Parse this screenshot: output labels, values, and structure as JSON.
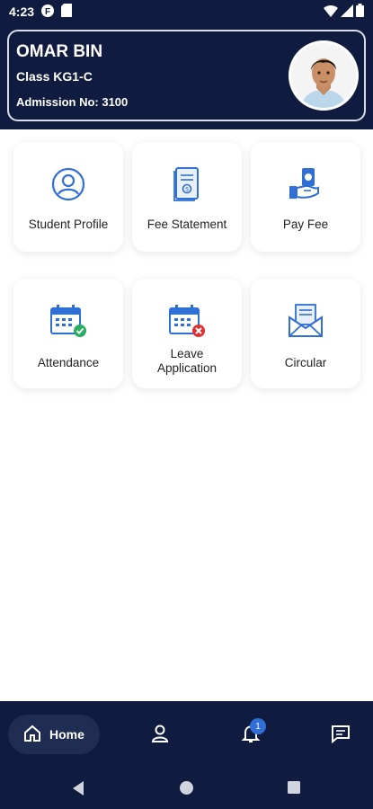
{
  "status_bar": {
    "time": "4:23",
    "icons": [
      "notification-f-icon",
      "sim-card-icon",
      "wifi-icon",
      "signal-icon",
      "battery-icon"
    ]
  },
  "profile": {
    "name": "OMAR BIN",
    "class": "Class KG1-C",
    "admission": "Admission No: 3100"
  },
  "tiles": [
    {
      "label": "Student Profile",
      "icon": "student-profile-icon"
    },
    {
      "label": "Fee Statement",
      "icon": "fee-statement-icon"
    },
    {
      "label": "Pay Fee",
      "icon": "pay-fee-icon"
    },
    {
      "label": "Attendance",
      "icon": "attendance-icon"
    },
    {
      "label_line1": "Leave",
      "label_line2": "Application",
      "icon": "leave-application-icon"
    },
    {
      "label": "Circular",
      "icon": "circular-icon"
    }
  ],
  "bottom_nav": {
    "home_label": "Home",
    "notification_count": "1",
    "items": [
      "home-icon",
      "profile-icon",
      "bell-icon",
      "chat-icon"
    ]
  },
  "colors": {
    "header_bg": "#0f1c3f",
    "accent_blue": "#2f6fd6",
    "success_green": "#27ae60",
    "error_red": "#e03131"
  }
}
